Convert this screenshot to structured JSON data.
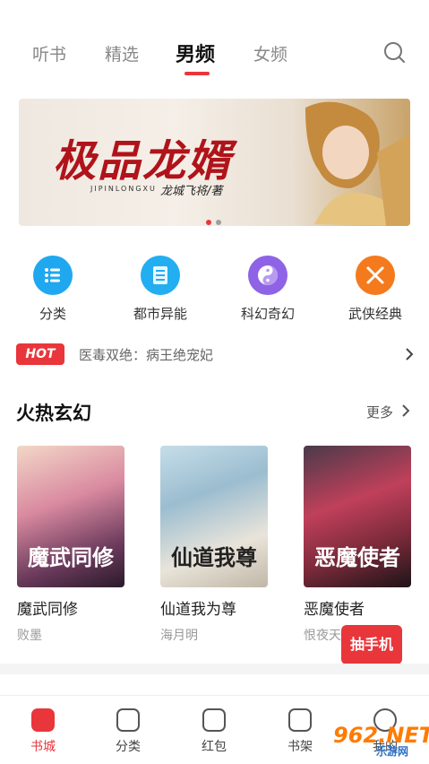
{
  "top_tabs": [
    "听书",
    "精选",
    "男频",
    "女频"
  ],
  "active_tab": "男频",
  "banner": {
    "title": "极品龙婿",
    "pinyin": "JIPINLONGXU",
    "author": "龙城飞将/著"
  },
  "categories": [
    {
      "label": "分类",
      "icon": "list-icon",
      "color": "#1fa8ef"
    },
    {
      "label": "都市异能",
      "icon": "building-icon",
      "color": "#22aef0"
    },
    {
      "label": "科幻奇幻",
      "icon": "yin-yang-icon",
      "color": "#8e63e6"
    },
    {
      "label": "武侠经典",
      "icon": "swords-icon",
      "color": "#f57a1d"
    }
  ],
  "hot": {
    "badge": "HOT",
    "text": "医毒双绝：病王绝宠妃"
  },
  "section": {
    "title": "火热玄幻",
    "more": "更多"
  },
  "books": [
    {
      "title": "魔武同修",
      "author": "败墨",
      "cover_text": "魔武同修"
    },
    {
      "title": "仙道我为尊",
      "author": "海月明",
      "cover_text": "仙道我尊"
    },
    {
      "title": "恶魔使者",
      "author": "恨夜天",
      "cover_text": "恶魔使者"
    }
  ],
  "promo": "抽手机",
  "bottom_nav": [
    {
      "label": "书城",
      "active": true
    },
    {
      "label": "分类",
      "active": false
    },
    {
      "label": "红包",
      "active": false
    },
    {
      "label": "书架",
      "active": false
    },
    {
      "label": "我的",
      "active": false
    }
  ],
  "watermark": {
    "text": "962.NET",
    "sub": "乐游网"
  },
  "colors": {
    "accent": "#e8363b",
    "hot_badge": "#e8363b"
  }
}
